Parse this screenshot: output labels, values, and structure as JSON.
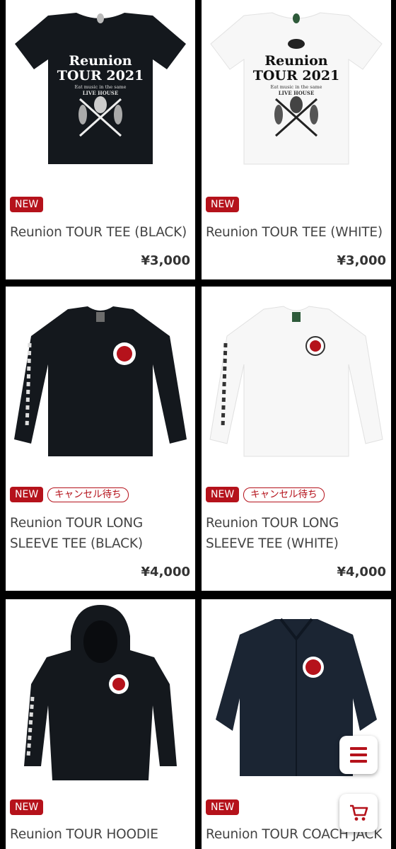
{
  "products": [
    {
      "name": "Reunion TOUR TEE (BLACK)",
      "price": "¥3,000",
      "badge_new": "NEW"
    },
    {
      "name": "Reunion TOUR TEE (WHITE)",
      "price": "¥3,000",
      "badge_new": "NEW"
    },
    {
      "name": "Reunion TOUR LONG SLEEVE TEE (BLACK)",
      "price": "¥4,000",
      "badge_new": "NEW",
      "badge_status": "キャンセル待ち"
    },
    {
      "name": "Reunion TOUR LONG SLEEVE TEE (WHITE)",
      "price": "¥4,000",
      "badge_new": "NEW",
      "badge_status": "キャンセル待ち"
    },
    {
      "name": "Reunion TOUR HOODIE",
      "badge_new": "NEW"
    },
    {
      "name": "Reunion TOUR COACH JACK",
      "badge_new": "NEW"
    }
  ],
  "print": {
    "tee_title_1": "Reunion",
    "tee_title_2": "TOUR 2021",
    "tee_tag_1": "Eat music in the same",
    "tee_tag_2": "LIVE HOUSE"
  },
  "icons": {
    "menu": "hamburger-menu-icon",
    "cart": "shopping-cart-icon"
  },
  "colors": {
    "accent": "#b5121b",
    "garment_black": "#14181d",
    "garment_navy": "#1b2533",
    "garment_white": "#f7f7f7"
  }
}
